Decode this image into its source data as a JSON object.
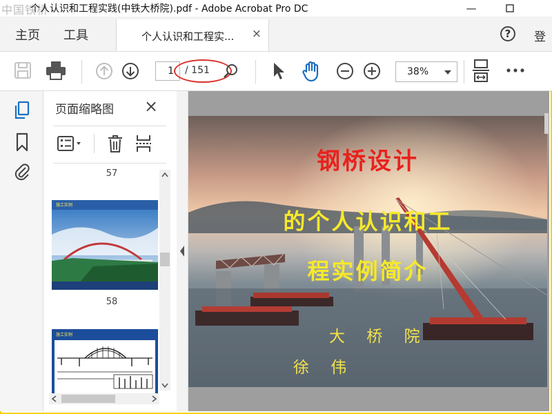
{
  "window": {
    "watermark": "中国铁桥",
    "title": "个人认识和工程实践(中铁大桥院).pdf - Adobe Acrobat Pro DC",
    "minimize": "—",
    "maximize": "☐"
  },
  "menu": {
    "home": "主页",
    "tools": "工具",
    "doc_tab_label": "个人认识和工程实...",
    "doc_tab_close": "×",
    "help": "?",
    "login": "登"
  },
  "toolbar": {
    "page_current": "1",
    "page_total": "/ 151",
    "zoom": "38%",
    "icons": [
      "save-icon",
      "print-icon",
      "page-up-icon",
      "page-down-icon",
      "magnifier-icon",
      "select-cursor-icon",
      "hand-tool-icon",
      "zoom-out-icon",
      "zoom-in-icon",
      "fit-page-icon",
      "more-icon"
    ],
    "highlight_color": "#d9302b"
  },
  "panel": {
    "title": "页面缩略图",
    "close": "×",
    "thumb_labels": [
      "57",
      "58"
    ],
    "thumb_heading": "施工实例"
  },
  "slide": {
    "title_line1": "钢桥设计",
    "title_line2": "的个人认识和工",
    "title_line3": "程实例简介",
    "org": "大 桥 院",
    "author": "徐 伟",
    "title_color": "#e8221e",
    "subtitle_color": "#f6e92b"
  }
}
